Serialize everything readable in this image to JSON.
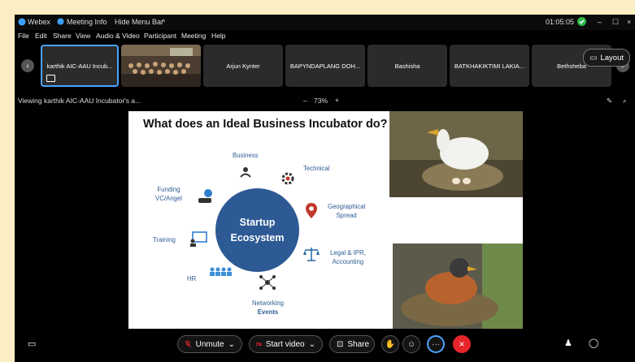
{
  "titlebar": {
    "app": "Webex",
    "meeting_info": "Meeting Info",
    "hide_menu": "Hide Menu Bar",
    "timer": "01:05:05"
  },
  "menu": [
    "File",
    "Edit",
    "Share",
    "View",
    "Audio & Video",
    "Participant",
    "Meeting",
    "Help"
  ],
  "participants": [
    "karthik AIC-AAU Incub...",
    "",
    "Arjun Kynter",
    "BAPYNDAPLANG DOH...",
    "Bashisha",
    "BATKHAKIKTIMI LAKIA...",
    "Bethsheba"
  ],
  "layout_label": "Layout",
  "viewing_text": "Viewing karthik AIC-AAU Incubator's a...",
  "zoom": {
    "minus": "–",
    "value": "73%",
    "plus": "+"
  },
  "slide": {
    "title": "What does an Ideal  Business Incubator do?",
    "center_line1": "Startup",
    "center_line2": "Ecosystem",
    "labels": {
      "business": "Business",
      "technical": "Technical",
      "funding1": "Funding",
      "funding2": "VC/Angel",
      "geo1": "Geographical",
      "geo2": "Spread",
      "training": "Training",
      "legal1": "Legal & IPR,",
      "legal2": "Accounting",
      "hr": "HR",
      "networking1": "Networking",
      "networking2": "Events"
    }
  },
  "controls": {
    "unmute": "Unmute",
    "start_video": "Start video",
    "share": "Share",
    "more": "···"
  },
  "colors": {
    "accent_blue": "#4aa3ff",
    "eco_blue": "#2d5a95",
    "label_blue": "#2e5d94",
    "end_red": "#e5252a"
  }
}
